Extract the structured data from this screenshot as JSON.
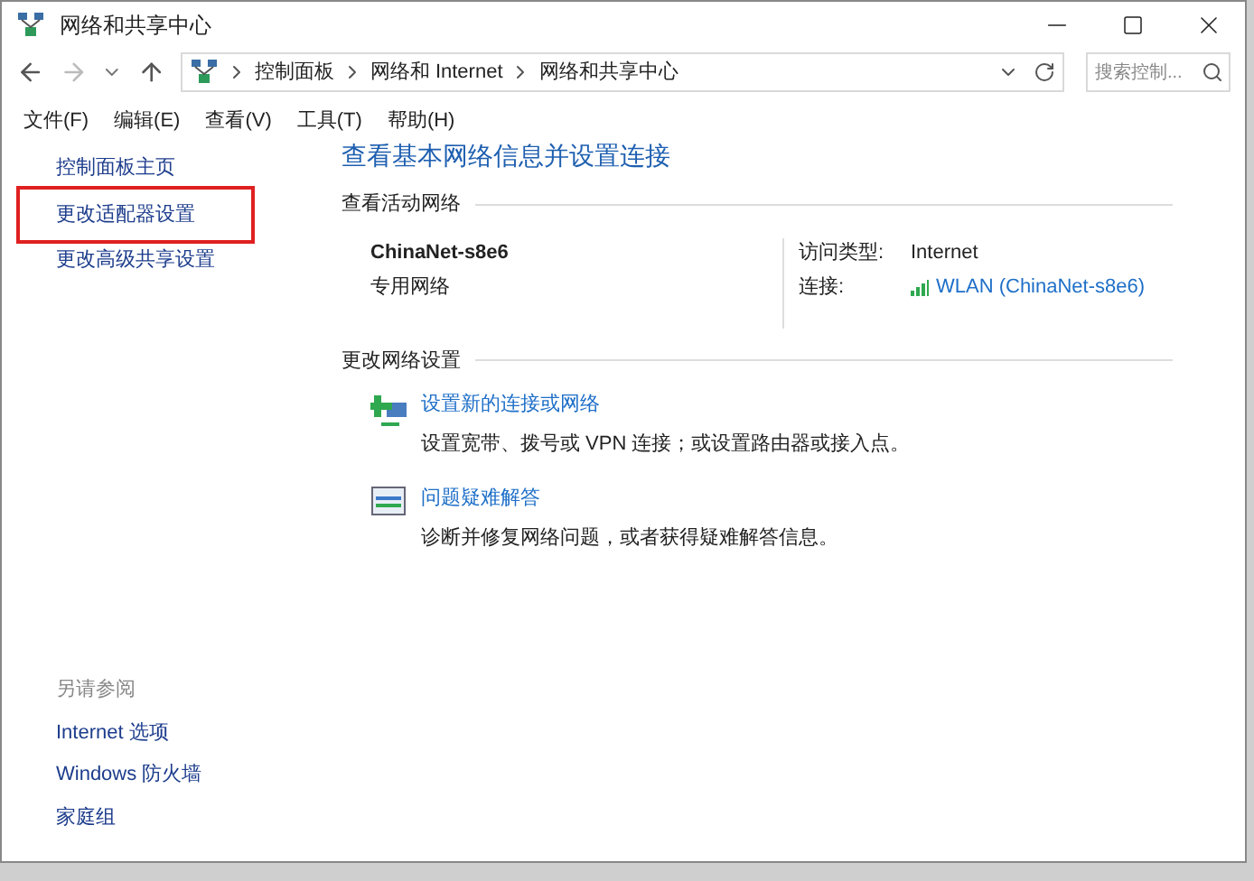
{
  "window": {
    "title": "网络和共享中心"
  },
  "address_bar": {
    "crumbs": [
      "控制面板",
      "网络和 Internet",
      "网络和共享中心"
    ],
    "search_placeholder": "搜索控制..."
  },
  "menu": [
    "文件(F)",
    "编辑(E)",
    "查看(V)",
    "工具(T)",
    "帮助(H)"
  ],
  "sidebar": {
    "items": [
      {
        "label": "控制面板主页",
        "highlighted": false
      },
      {
        "label": "更改适配器设置",
        "highlighted": true
      },
      {
        "label": "更改高级共享设置",
        "highlighted": false
      }
    ],
    "see_also_title": "另请参阅",
    "see_also": [
      "Internet 选项",
      "Windows 防火墙",
      "家庭组"
    ]
  },
  "heading": "查看基本网络信息并设置连接",
  "active_networks": {
    "title": "查看活动网络",
    "name": "ChinaNet-s8e6",
    "type": "专用网络",
    "access_label": "访问类型:",
    "access_value": "Internet",
    "connection_label": "连接:",
    "connection_value": "WLAN (ChinaNet-s8e6)"
  },
  "change_settings": {
    "title": "更改网络设置",
    "tasks": [
      {
        "kind": "new-connection",
        "link": "设置新的连接或网络",
        "description": "设置宽带、拨号或 VPN 连接；或设置路由器或接入点。"
      },
      {
        "kind": "troubleshoot",
        "link": "问题疑难解答",
        "description": "诊断并修复网络问题，或者获得疑难解答信息。"
      }
    ]
  }
}
